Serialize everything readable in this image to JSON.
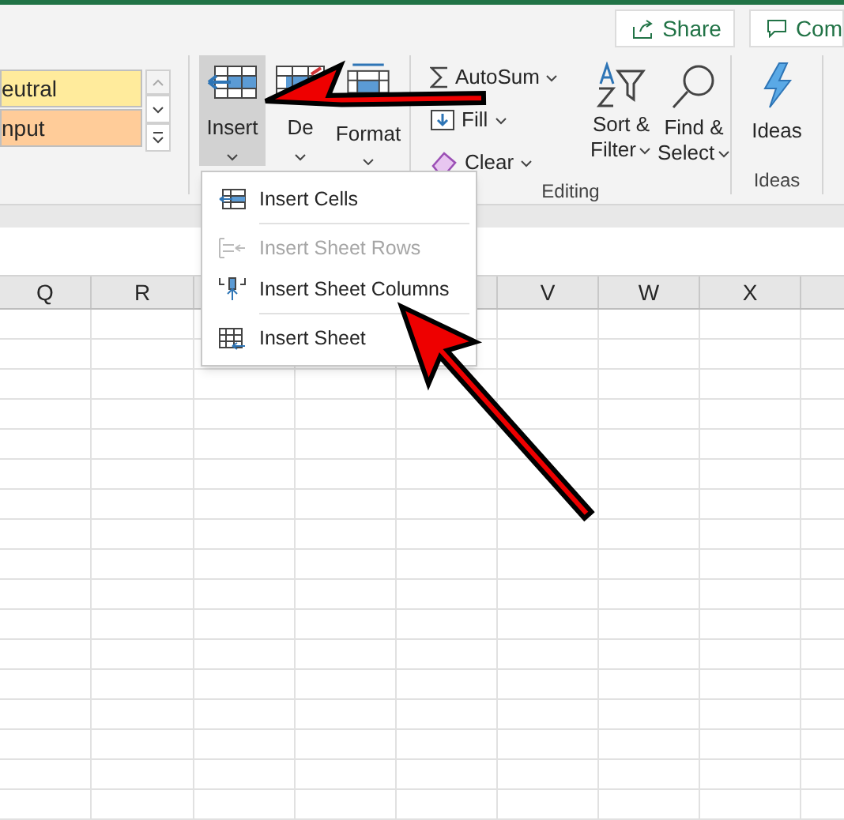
{
  "top_buttons": [
    {
      "label": "Share",
      "kind": "share"
    },
    {
      "label": "Com",
      "kind": "comment"
    }
  ],
  "styles_gallery": {
    "cells": [
      {
        "label": "eutral",
        "color": "#ffeb9c"
      },
      {
        "label": "nput",
        "color": "#ffcc99"
      }
    ]
  },
  "cells_group": {
    "buttons": [
      {
        "label": "Insert",
        "kind": "insert",
        "selected": true
      },
      {
        "label": "De",
        "kind": "delete",
        "selected": false
      },
      {
        "label": "Format",
        "kind": "format",
        "selected": false
      }
    ]
  },
  "editing_group": {
    "label": "Editing",
    "small_buttons": [
      {
        "label": "AutoSum",
        "kind": "sum"
      },
      {
        "label": "Fill",
        "kind": "fill"
      },
      {
        "label": "Clear",
        "kind": "clear"
      }
    ],
    "large_buttons": [
      {
        "line1": "Sort &",
        "line2": "Filter",
        "kind": "sort"
      },
      {
        "line1": "Find &",
        "line2": "Select",
        "kind": "find"
      }
    ]
  },
  "ideas_group": {
    "label": "Ideas",
    "button": "Ideas"
  },
  "insert_menu": {
    "items": [
      {
        "label": "Insert Cells",
        "kind": "cells",
        "disabled": false
      },
      {
        "label": "Insert Sheet Rows",
        "kind": "rows",
        "disabled": true
      },
      {
        "label": "Insert Sheet Columns",
        "kind": "columns",
        "disabled": false
      },
      {
        "label": "Insert Sheet",
        "kind": "sheet",
        "disabled": false
      }
    ]
  },
  "sheet": {
    "columns": [
      {
        "label": "Q"
      },
      {
        "label": "R"
      },
      {
        "label": "V"
      },
      {
        "label": "W"
      },
      {
        "label": "X"
      }
    ]
  }
}
